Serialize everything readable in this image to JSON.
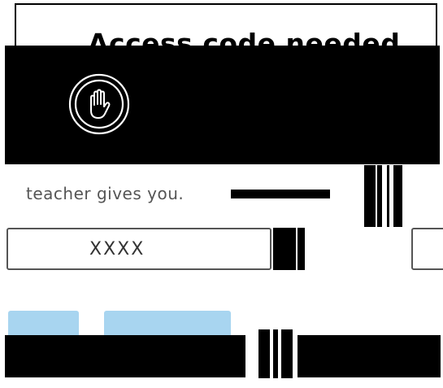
{
  "dialog": {
    "title": "Access code needed",
    "hero_icon": "raised-hand-icon",
    "instruction_visible": "teacher gives you.",
    "code_input": {
      "value": "",
      "placeholder": "XXXX"
    }
  },
  "colors": {
    "hero_background": "#000000",
    "button_background": "#a8d5f0",
    "input_border": "#555555"
  }
}
